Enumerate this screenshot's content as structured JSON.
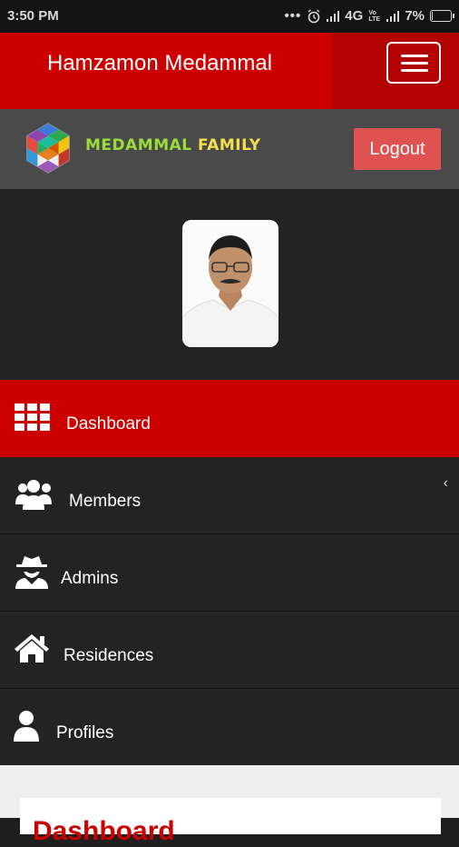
{
  "status_bar": {
    "time": "3:50 PM",
    "network": "4G",
    "network_sub": "Vo LTE",
    "battery": "7%",
    "battery_level": 0.07,
    "icons": [
      "more-dots-icon",
      "alarm-icon",
      "signal-icon",
      "battery-icon"
    ]
  },
  "header": {
    "title": "Hamzamon Medammal",
    "menu_icon": "hamburger-menu-icon"
  },
  "brand": {
    "name_part1": "MEDAMMAL",
    "name_part2": "FAMILY",
    "logout_label": "Logout"
  },
  "nav": {
    "items": [
      {
        "label": "Dashboard",
        "icon": "grid-icon",
        "active": true
      },
      {
        "label": "Members",
        "icon": "users-icon",
        "active": false
      },
      {
        "label": "Admins",
        "icon": "spy-icon",
        "active": false
      },
      {
        "label": "Residences",
        "icon": "home-icon",
        "active": false
      },
      {
        "label": "Profiles",
        "icon": "user-icon",
        "active": false
      }
    ],
    "collapse_glyph": "‹"
  },
  "content": {
    "card_title": "Dashboard"
  },
  "colors": {
    "primary_red": "#cc0000",
    "logout_red": "#e05252",
    "sidebar_dark": "#232323",
    "brand_green": "#9bdc3a",
    "brand_yellow": "#f3e04a"
  }
}
